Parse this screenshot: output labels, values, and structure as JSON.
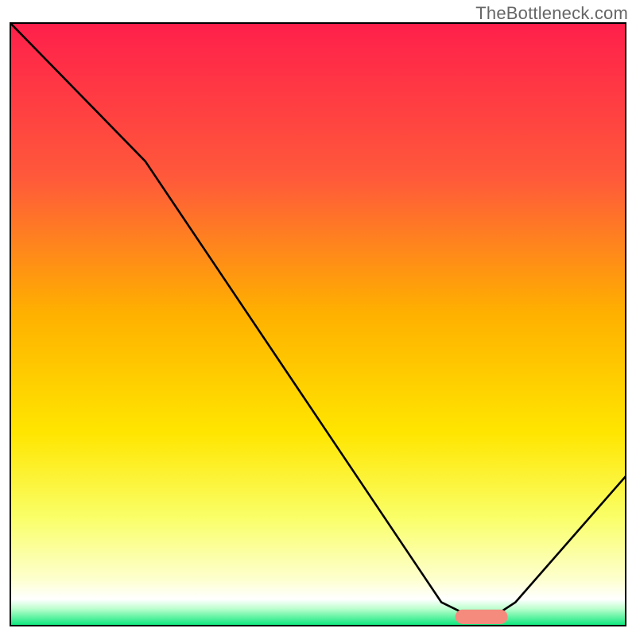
{
  "watermark": "TheBottleneck.com",
  "chart_data": {
    "type": "line",
    "title": "",
    "xlabel": "",
    "ylabel": "",
    "xlim": [
      0,
      100
    ],
    "ylim": [
      0,
      100
    ],
    "background_gradient_stops": [
      {
        "offset": 0.0,
        "color": "#ff1f4b"
      },
      {
        "offset": 0.26,
        "color": "#ff5a3a"
      },
      {
        "offset": 0.48,
        "color": "#ffb000"
      },
      {
        "offset": 0.68,
        "color": "#ffe600"
      },
      {
        "offset": 0.82,
        "color": "#faff68"
      },
      {
        "offset": 0.92,
        "color": "#fdffcc"
      },
      {
        "offset": 0.955,
        "color": "#ffffff"
      },
      {
        "offset": 0.97,
        "color": "#bfffd0"
      },
      {
        "offset": 1.0,
        "color": "#00e676"
      }
    ],
    "series": [
      {
        "name": "bottleneck-curve",
        "x": [
          0,
          22,
          70,
          74,
          79,
          82,
          100
        ],
        "values": [
          100,
          77,
          4,
          2,
          2,
          4,
          25
        ],
        "stroke": "#000000",
        "stroke_width": 2.6
      }
    ],
    "marker": {
      "name": "optimal-zone",
      "shape": "rounded-bar",
      "x_center": 76.5,
      "y_center": 1.6,
      "width": 8.5,
      "height": 2.4,
      "fill": "#f58b7d",
      "rx": 1.2
    }
  }
}
